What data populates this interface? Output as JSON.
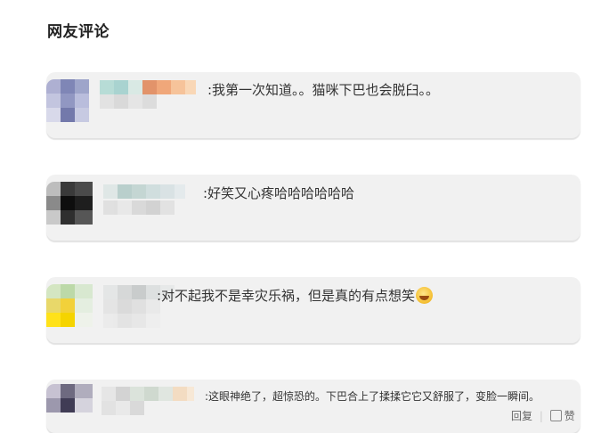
{
  "section": {
    "title": "网友评论"
  },
  "comments": [
    {
      "text": ":我第一次知道。。猫咪下巴也会脱臼。。"
    },
    {
      "text": ":好笑又心疼哈哈哈哈哈哈"
    },
    {
      "text": ":对不起我不是幸灾乐祸，但是真的有点想笑"
    },
    {
      "text": ":这眼神绝了，超惊恐的。下巴合上了揉揉它它又舒服了，变脸一瞬间。"
    }
  ],
  "actions": {
    "reply": "回复",
    "like": "赞"
  },
  "colors": {
    "card_bg": "#f1f1f1",
    "text": "#333333",
    "title": "#222222"
  },
  "icons": {
    "emoji": "laugh-cry-emoji",
    "like": "thumb-up-icon"
  }
}
